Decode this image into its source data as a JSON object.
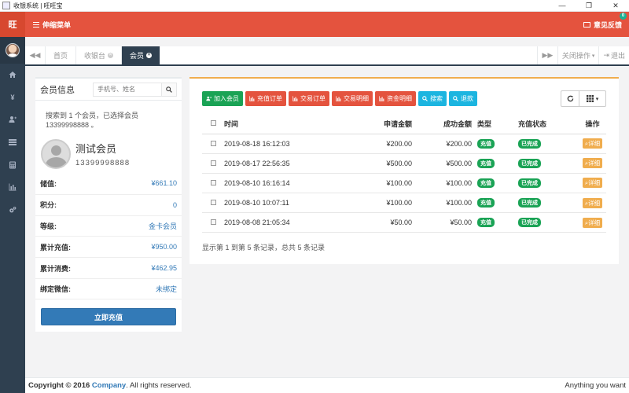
{
  "window": {
    "title": "收银系统 | 旺旺宝",
    "buttons": [
      "—",
      "❐",
      "✕"
    ]
  },
  "header": {
    "logo": "旺",
    "menu_toggle": "伸缩菜单",
    "feedback": "意见反馈",
    "feedback_badge": "0"
  },
  "sidebar": {
    "items": [
      "home-icon",
      "yen-icon",
      "user-plus-icon",
      "list-icon",
      "calculator-icon",
      "bar-chart-icon",
      "cogs-icon"
    ]
  },
  "tabs": {
    "items": [
      {
        "label": "首页",
        "closable": false
      },
      {
        "label": "收银台",
        "closable": true
      },
      {
        "label": "会员",
        "closable": true,
        "active": true
      }
    ],
    "close_ops": "关闭操作",
    "logout": "退出"
  },
  "member_panel": {
    "title": "会员信息",
    "search_placeholder": "手机号、姓名",
    "found_text": "搜索到 1 个会员，已选择会员13399998888 。",
    "name": "测试会员",
    "phone": "13399998888",
    "stats": [
      {
        "label": "储值:",
        "value": "¥661.10"
      },
      {
        "label": "积分:",
        "value": "0"
      },
      {
        "label": "等级:",
        "value": "金卡会员"
      },
      {
        "label": "累计充值:",
        "value": "¥950.00"
      },
      {
        "label": "累计消费:",
        "value": "¥462.95"
      },
      {
        "label": "绑定微信:",
        "value": "未绑定"
      }
    ],
    "recharge_button": "立即充值"
  },
  "records_panel": {
    "toolbar": [
      {
        "label": "加入会员",
        "color": "#1aa355",
        "icon": "user-plus-icon"
      },
      {
        "label": "充值订单",
        "color": "#e4533e",
        "icon": "bar-chart-icon"
      },
      {
        "label": "交易订单",
        "color": "#e4533e",
        "icon": "bar-chart-icon"
      },
      {
        "label": "交易明细",
        "color": "#e4533e",
        "icon": "bar-chart-icon"
      },
      {
        "label": "资金明细",
        "color": "#e4533e",
        "icon": "bar-chart-icon"
      },
      {
        "label": "搜索",
        "color": "#1cb5e0",
        "icon": "search-icon"
      },
      {
        "label": "退款",
        "color": "#1cb5e0",
        "icon": "search-icon"
      }
    ],
    "columns": [
      "时间",
      "申请金额",
      "成功金额",
      "类型",
      "充值状态",
      "操作"
    ],
    "rows": [
      {
        "time": "2019-08-18 16:12:03",
        "apply": "¥200.00",
        "success": "¥200.00",
        "type": "充值",
        "status": "已完成",
        "action": "详细"
      },
      {
        "time": "2019-08-17 22:56:35",
        "apply": "¥500.00",
        "success": "¥500.00",
        "type": "充值",
        "status": "已完成",
        "action": "详细"
      },
      {
        "time": "2019-08-10 16:16:14",
        "apply": "¥100.00",
        "success": "¥100.00",
        "type": "充值",
        "status": "已完成",
        "action": "详细"
      },
      {
        "time": "2019-08-10 10:07:11",
        "apply": "¥100.00",
        "success": "¥100.00",
        "type": "充值",
        "status": "已完成",
        "action": "详细"
      },
      {
        "time": "2019-08-08 21:05:34",
        "apply": "¥50.00",
        "success": "¥50.00",
        "type": "充值",
        "status": "已完成",
        "action": "详细"
      }
    ],
    "summary": "显示第 1 到第 5 条记录，总共 5 条记录"
  },
  "footer": {
    "copyright_prefix": "Copyright © 2016",
    "company": "Company",
    "copyright_suffix": ". All rights reserved.",
    "right_text": "Anything you want"
  },
  "colors": {
    "header": "#e4533e",
    "sidebar": "#2f4050",
    "primary": "#337ab7",
    "success": "#1aa355",
    "warning": "#f0ad4e",
    "info": "#1cb5e0"
  }
}
